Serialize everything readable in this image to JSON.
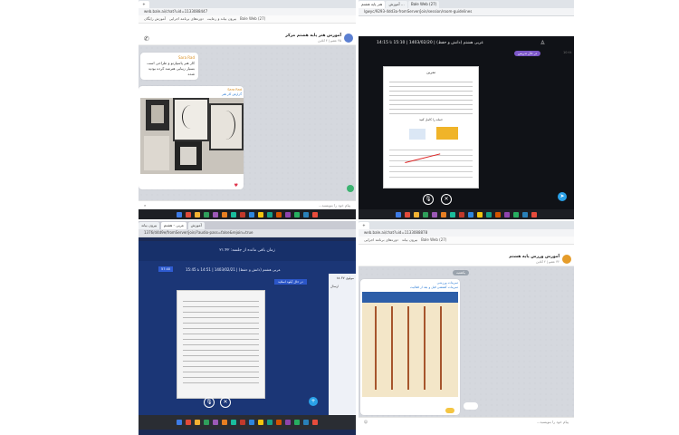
{
  "q1": {
    "address": "web.bale.ai/chat?uid=1133088447",
    "bookmarks": [
      "بیرون بیاند و رعایت",
      "دوره‌های برنامه اجرایی",
      "آموزش رایگان",
      "Bale Web (27)"
    ],
    "chat_title": "آموزش هنر پایه هشتم مرکز",
    "chat_subtitle": "۴۵ عضو | ۴ آنلاین",
    "sender_name": "Sara Rad",
    "message_text": "کار هنر پاسپارتو و طراحی است بسیار زیبایی هنرمند کرده بودید شده",
    "reply_sender": "Sara Rad",
    "reply_caption": "گزارش کار هنر",
    "reaction": "♥",
    "input_placeholder": "پیام خود را بنویسید..."
  },
  "q2": {
    "tabs": [
      "هنر پایه هشتم",
      "آموزش ...",
      "Bale Web (27)"
    ],
    "address": "lgwyc/9293-4dd3a-fromServer/join/session/room-guidelines",
    "class_title": "عربی هشتم (دانش و حفظ) | 1403/02/20 | 15:10 تا 14:15",
    "status_badge": "در حال تدریس",
    "side_times": [
      "10:۲۸",
      "10:۲۹",
      "10:۳۰"
    ],
    "doc_heading": "تمرین",
    "doc_section": "جمله را کامل کنید"
  },
  "q3": {
    "address": "1376/d4d9e/fromServer/join/?audio-pass=false&rejoin=true",
    "tabs": [
      "بیرون بیاند",
      "عربی - هشتم",
      "آموزش"
    ],
    "notice": "زمان باقی مانده از جلسه: ۲۱:۴۲",
    "class_title": "عربی هشتم (دانش و حفظ) | 1403/02/21 | 14:51 تا 15:45",
    "status_badge": "در حال آپلود اسلاید",
    "badge_time": "57:40",
    "side_badge": "مولوی ۳۷ ۸۸",
    "side_label": "ارسال"
  },
  "q4": {
    "address": "web.bale.ai/chat?uid=1133088878",
    "bookmarks": [
      "بیرون بیاند",
      "دوره‌های برنامه اجرایی",
      "Bale Web (27)"
    ],
    "chat_title": "آموزش ورزش پایه هشتم",
    "chat_subtitle": "۳۲ عضو | ۲ آنلاین",
    "date_chip": "یکشنبه",
    "poster_title": "تمرینات ورزشی",
    "poster_subtitle": "تمرینات کششی قبل و بعد از فعالیت",
    "input_placeholder": "پیام خود را بنویسید..."
  },
  "taskbar_colors": [
    "#3d7be6",
    "#e24a3a",
    "#f2b233",
    "#2f9e5b",
    "#9b59b6",
    "#e67e22",
    "#1abc9c",
    "#c0392b",
    "#2e86de",
    "#f1c40f",
    "#16a085",
    "#d35400",
    "#8e44ad",
    "#27ae60",
    "#2980b9",
    "#e74c3c"
  ]
}
